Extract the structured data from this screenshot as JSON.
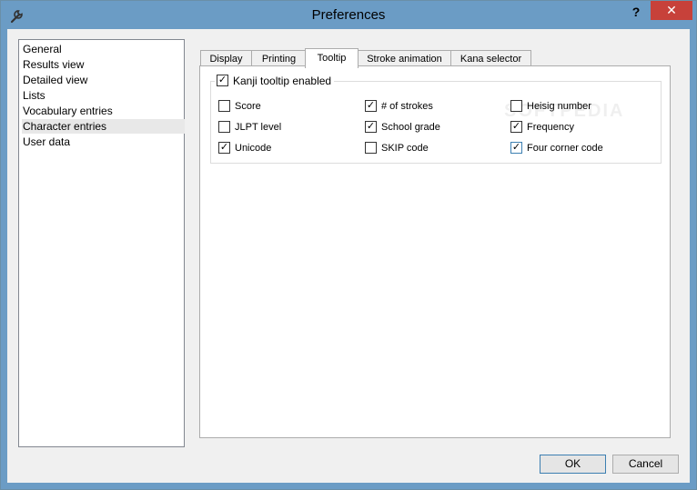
{
  "window": {
    "title": "Preferences",
    "help_label": "?",
    "close_label": "✕"
  },
  "categories": [
    {
      "label": "General"
    },
    {
      "label": "Results view"
    },
    {
      "label": "Detailed view"
    },
    {
      "label": "Lists"
    },
    {
      "label": "Vocabulary entries"
    },
    {
      "label": "Character entries"
    },
    {
      "label": "User data"
    }
  ],
  "selected_category": "Character entries",
  "tabs": [
    {
      "label": "Display"
    },
    {
      "label": "Printing"
    },
    {
      "label": "Tooltip"
    },
    {
      "label": "Stroke animation"
    },
    {
      "label": "Kana selector"
    }
  ],
  "active_tab": "Tooltip",
  "tooltip": {
    "enabled_label": "Kanji tooltip enabled",
    "enabled_checked": true,
    "options": [
      {
        "label": "Score",
        "checked": false
      },
      {
        "label": "# of strokes",
        "checked": true
      },
      {
        "label": "Heisig number",
        "checked": false
      },
      {
        "label": "JLPT level",
        "checked": false
      },
      {
        "label": "School grade",
        "checked": true
      },
      {
        "label": "Frequency",
        "checked": true
      },
      {
        "label": "Unicode",
        "checked": true
      },
      {
        "label": "SKIP code",
        "checked": false
      },
      {
        "label": "Four corner code",
        "checked": true
      }
    ]
  },
  "watermark": {
    "text": "SOFTPEDIA"
  },
  "buttons": {
    "ok_label": "OK",
    "cancel_label": "Cancel"
  },
  "colors": {
    "titlebar": "#6b9cc5",
    "close_button": "#c7413a"
  },
  "icons": {
    "app": "wrench-icon",
    "close": "close-icon",
    "help": "help-icon",
    "check": "check-icon"
  }
}
